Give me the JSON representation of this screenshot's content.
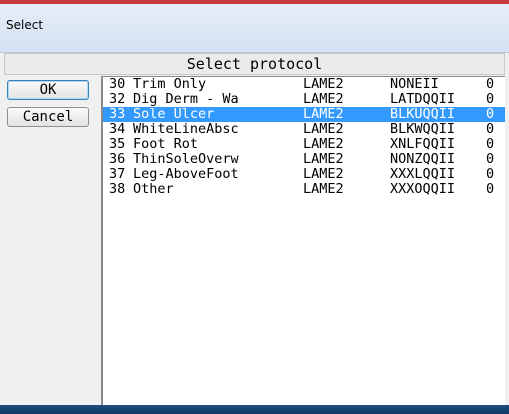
{
  "window": {
    "title": "Select"
  },
  "header": {
    "title": "Select protocol"
  },
  "buttons": {
    "ok_label": "OK",
    "cancel_label": "Cancel"
  },
  "list": {
    "rows": [
      {
        "num": "30",
        "name": "Trim Only",
        "group": "LAME2",
        "code": "NONEII",
        "value": "0",
        "selected": false
      },
      {
        "num": "32",
        "name": "Dig Derm - Wa",
        "group": "LAME2",
        "code": "LATDQQII",
        "value": "0",
        "selected": false
      },
      {
        "num": "33",
        "name": "Sole Ulcer",
        "group": "LAME2",
        "code": "BLKUQQII",
        "value": "0",
        "selected": true
      },
      {
        "num": "34",
        "name": "WhiteLineAbsc",
        "group": "LAME2",
        "code": "BLKWQQII",
        "value": "0",
        "selected": false
      },
      {
        "num": "35",
        "name": "Foot Rot",
        "group": "LAME2",
        "code": "XNLFQQII",
        "value": "0",
        "selected": false
      },
      {
        "num": "36",
        "name": "ThinSoleOverw",
        "group": "LAME2",
        "code": "NONZQQII",
        "value": "0",
        "selected": false
      },
      {
        "num": "37",
        "name": "Leg-AboveFoot",
        "group": "LAME2",
        "code": "XXXLQQII",
        "value": "0",
        "selected": false
      },
      {
        "num": "38",
        "name": "Other",
        "group": "LAME2",
        "code": "XXXOQQII",
        "value": "0",
        "selected": false
      }
    ]
  },
  "colors": {
    "selection": "#3399ff",
    "taskbar": "#1d4f84",
    "accent": "#c63b3b"
  }
}
